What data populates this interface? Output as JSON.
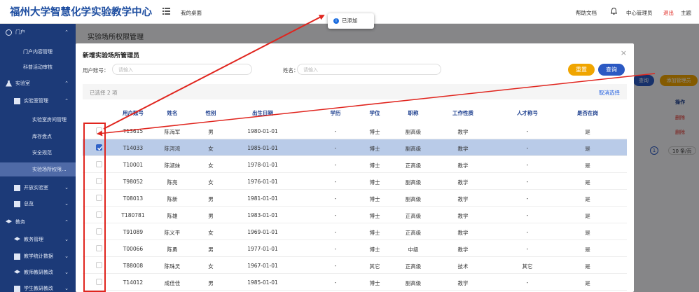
{
  "header": {
    "app_title": "福州大学智慧化学实验教学中心",
    "my_desk": "我的桌面",
    "help": "帮助文档",
    "user": "中心管理员",
    "logout": "退出",
    "home": "主题"
  },
  "toast": {
    "text": "已添加"
  },
  "sidebar": {
    "items": [
      {
        "label": "门户"
      },
      {
        "label": "门户内容管理"
      },
      {
        "label": "科普活动审核"
      },
      {
        "label": "实验室"
      },
      {
        "label": "实验室管理"
      },
      {
        "label": "实验室房间管理"
      },
      {
        "label": "库存盘点"
      },
      {
        "label": "安全规范"
      },
      {
        "label": "实验场所权限..."
      },
      {
        "label": "开放实验室"
      },
      {
        "label": "总览"
      },
      {
        "label": "教务"
      },
      {
        "label": "教务管理"
      },
      {
        "label": "教学统计数据"
      },
      {
        "label": "教师教研教改"
      },
      {
        "label": "学生教研教改"
      }
    ]
  },
  "page": {
    "title": "实验场所权限管理",
    "bg_query": "查询",
    "bg_add_admin": "添加管理员",
    "bg_op_header": "操作",
    "bg_delete_1": "删除",
    "bg_delete_2": "删除",
    "bg_page": "1",
    "bg_page_size": "10 条/页"
  },
  "modal": {
    "title": "新增实验场所管理员",
    "close": "×",
    "user_account_label": "用户账号：",
    "user_account_placeholder": "请输入",
    "name_label": "姓名：",
    "name_placeholder": "请输入",
    "reset": "重置",
    "query": "查询",
    "selected_text": "已选择 2 项",
    "cancel_selection": "取消选择",
    "columns": [
      "用户账号",
      "姓名",
      "性别",
      "出生日期",
      "学历",
      "学位",
      "职称",
      "工作性质",
      "人才称号",
      "是否在岗"
    ],
    "rows": [
      {
        "account": "T13615",
        "name": "陈海军",
        "gender": "男",
        "birth": "1980-01-01",
        "edu": "-",
        "degree": "博士",
        "title": "副高级",
        "work": "教学",
        "talent": "-",
        "onduty": "是",
        "checked": false
      },
      {
        "account": "T14033",
        "name": "陈泻湾",
        "gender": "女",
        "birth": "1985-01-01",
        "edu": "-",
        "degree": "博士",
        "title": "副高级",
        "work": "教学",
        "talent": "-",
        "onduty": "是",
        "checked": true
      },
      {
        "account": "T10001",
        "name": "陈淑妹",
        "gender": "女",
        "birth": "1978-01-01",
        "edu": "-",
        "degree": "博士",
        "title": "正高级",
        "work": "教学",
        "talent": "-",
        "onduty": "是",
        "checked": false
      },
      {
        "account": "T98052",
        "name": "陈亮",
        "gender": "女",
        "birth": "1976-01-01",
        "edu": "-",
        "degree": "博士",
        "title": "副高级",
        "work": "教学",
        "talent": "-",
        "onduty": "是",
        "checked": false
      },
      {
        "account": "T08013",
        "name": "陈新",
        "gender": "男",
        "birth": "1981-01-01",
        "edu": "-",
        "degree": "博士",
        "title": "副高级",
        "work": "教学",
        "talent": "-",
        "onduty": "是",
        "checked": false
      },
      {
        "account": "T180781",
        "name": "陈雄",
        "gender": "男",
        "birth": "1983-01-01",
        "edu": "-",
        "degree": "博士",
        "title": "正高级",
        "work": "教学",
        "talent": "-",
        "onduty": "是",
        "checked": false
      },
      {
        "account": "T91089",
        "name": "陈义平",
        "gender": "女",
        "birth": "1969-01-01",
        "edu": "-",
        "degree": "博士",
        "title": "正高级",
        "work": "教学",
        "talent": "-",
        "onduty": "是",
        "checked": false
      },
      {
        "account": "T00066",
        "name": "陈勇",
        "gender": "男",
        "birth": "1977-01-01",
        "edu": "-",
        "degree": "博士",
        "title": "中级",
        "work": "教学",
        "talent": "-",
        "onduty": "是",
        "checked": false
      },
      {
        "account": "T88008",
        "name": "陈珠灵",
        "gender": "女",
        "birth": "1967-01-01",
        "edu": "-",
        "degree": "其它",
        "title": "正高级",
        "work": "技术",
        "talent": "其它",
        "onduty": "是",
        "checked": false
      },
      {
        "account": "T14012",
        "name": "成佳佳",
        "gender": "男",
        "birth": "1985-01-01",
        "edu": "-",
        "degree": "博士",
        "title": "副高级",
        "work": "教学",
        "talent": "-",
        "onduty": "是",
        "checked": false
      }
    ]
  },
  "colors": {
    "brand": "#1d4da0",
    "sidebar": "#1c3a78",
    "reset": "#f0a500",
    "query": "#2b59c3",
    "annotation": "#e0251e"
  }
}
